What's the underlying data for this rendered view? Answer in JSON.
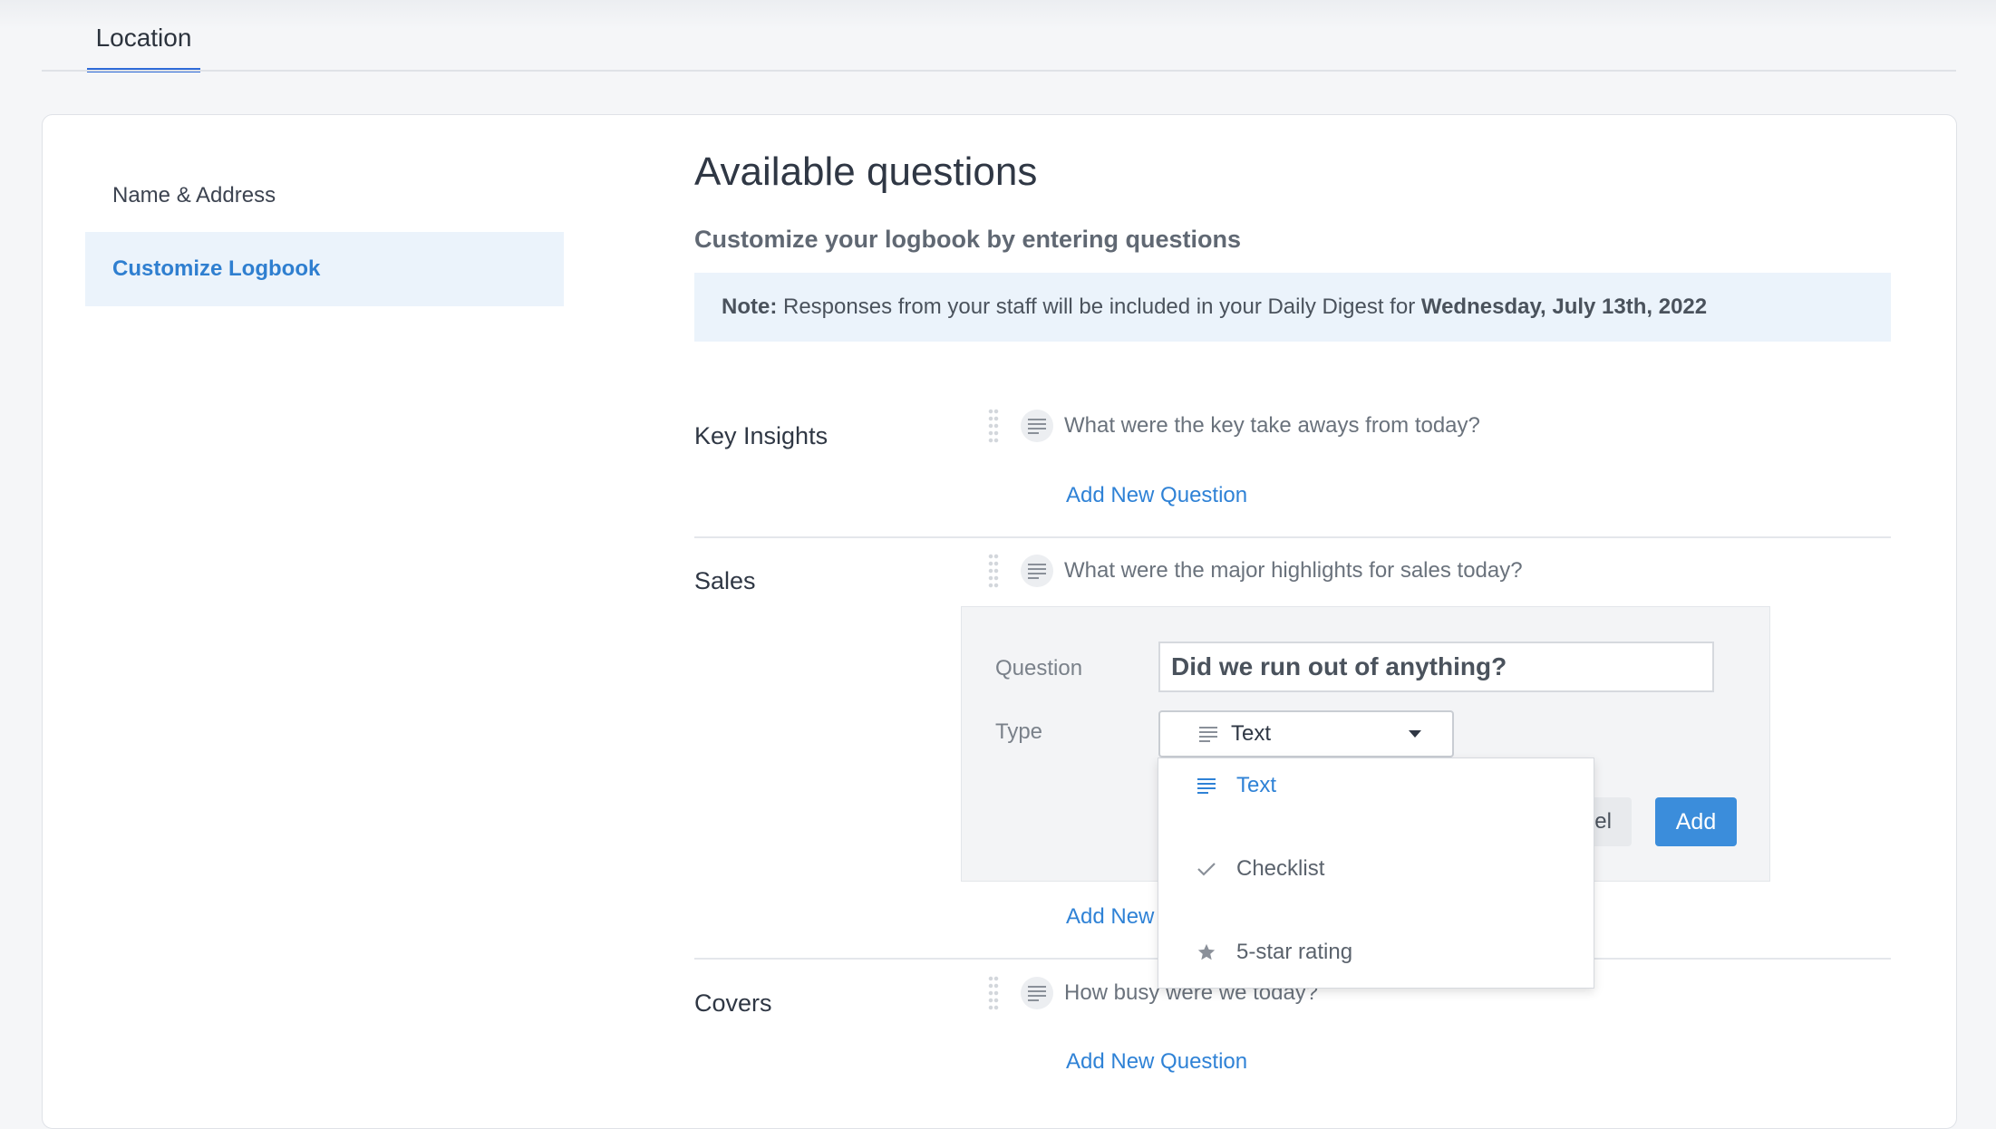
{
  "tabs": [
    {
      "label": "Location"
    }
  ],
  "sidebar": {
    "items": [
      {
        "label": "Name & Address"
      },
      {
        "label": "Customize Logbook"
      }
    ]
  },
  "main": {
    "title": "Available questions",
    "subtitle": "Customize your logbook by entering questions",
    "note": {
      "prefix": "Note:",
      "text": " Responses from your staff will be included in your Daily Digest for ",
      "date": "Wednesday, July 13th, 2022"
    },
    "sections": [
      {
        "label": "Key Insights",
        "question": "What were the key take aways from today?",
        "add_label": "Add New Question"
      },
      {
        "label": "Sales",
        "question": "What were the major highlights for sales today?",
        "add_label": "Add New"
      },
      {
        "label": "Covers",
        "question": "How busy were we today?",
        "add_label": "Add New Question"
      }
    ]
  },
  "editor": {
    "question_label": "Question",
    "question_value": "Did we run out of anything?",
    "type_label": "Type",
    "type_value": "Text",
    "cancel_label": "Cancel",
    "add_label": "Add"
  },
  "type_dropdown": {
    "options": [
      {
        "label": "Text",
        "icon": "lines-icon",
        "selected": true
      },
      {
        "label": "Checklist",
        "icon": "check-icon",
        "selected": false
      },
      {
        "label": "5-star rating",
        "icon": "star-icon",
        "selected": false
      }
    ]
  },
  "colors": {
    "accent": "#2f6bd8",
    "link": "#2f82d6",
    "active_bg": "#ebf3fb",
    "primary_button": "#3b8ddb"
  }
}
